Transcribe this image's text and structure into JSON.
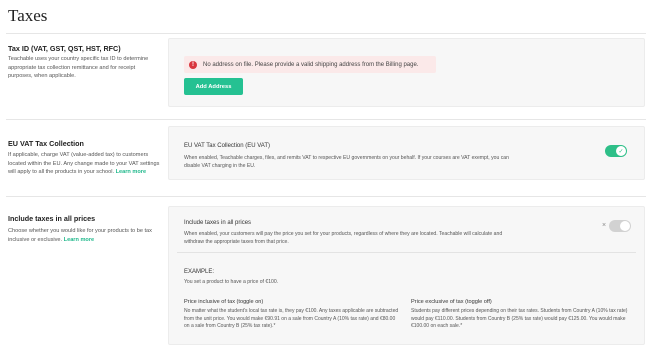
{
  "page": {
    "title": "Taxes"
  },
  "tax_id": {
    "title": "Tax ID (VAT, GST, QST, HST, RFC)",
    "description": "Teachable uses your country specific tax ID to determine appropriate tax collection remittance and for receipt purposes, when applicable.",
    "alert_text": "No address on file. Please provide a valid shipping address from the Billing page.",
    "add_address_label": "Add Address"
  },
  "eu_vat": {
    "title": "EU VAT Tax Collection",
    "description": "If applicable, charge VAT (value-added tax) to customers located within the EU. Any change made to your VAT settings will apply to all the products in your school.",
    "learn_more": "Learn more",
    "card_title": "EU VAT Tax Collection (EU VAT)",
    "card_text": "When enabled, Teachable charges, files, and remits VAT to respective EU governments on your behalf. If your courses are VAT exempt, you can disable VAT charging in the EU.",
    "toggle_on": true
  },
  "include_taxes": {
    "title": "Include taxes in all prices",
    "description": "Choose whether you would like for your products to be tax inclusive or exclusive.",
    "learn_more": "Learn more",
    "card_title": "Include taxes in all prices",
    "card_text": "When enabled, your customers will pay the price you set for your products, regardless of where they are located. Teachable will calculate and withdraw the appropriate taxes from that price.",
    "toggle_on": false,
    "example_label": "EXAMPLE:",
    "example_text": "You set a product to have a price of €100.",
    "inclusive_title": "Price inclusive of tax (toggle on)",
    "inclusive_text": "No matter what the student's local tax rate is, they pay €100. Any taxes applicable are subtracted from the unit price. You would make €90.91 on a sale from Country A (10% tax rate) and €80.00 on a sale from Country B (25% tax rate).*",
    "exclusive_title": "Price exclusive of tax (toggle off)",
    "exclusive_text": "Students pay different prices depending on their tax rates. Students from Country A (10% tax rate) would pay €110.00. Students from Country B (25% tax rate) would pay €125.00. You would make €100.00 on each sale.*"
  },
  "colors": {
    "accent": "#25c192",
    "alert_bg": "#fbe9e9",
    "alert_icon": "#d9363e"
  }
}
